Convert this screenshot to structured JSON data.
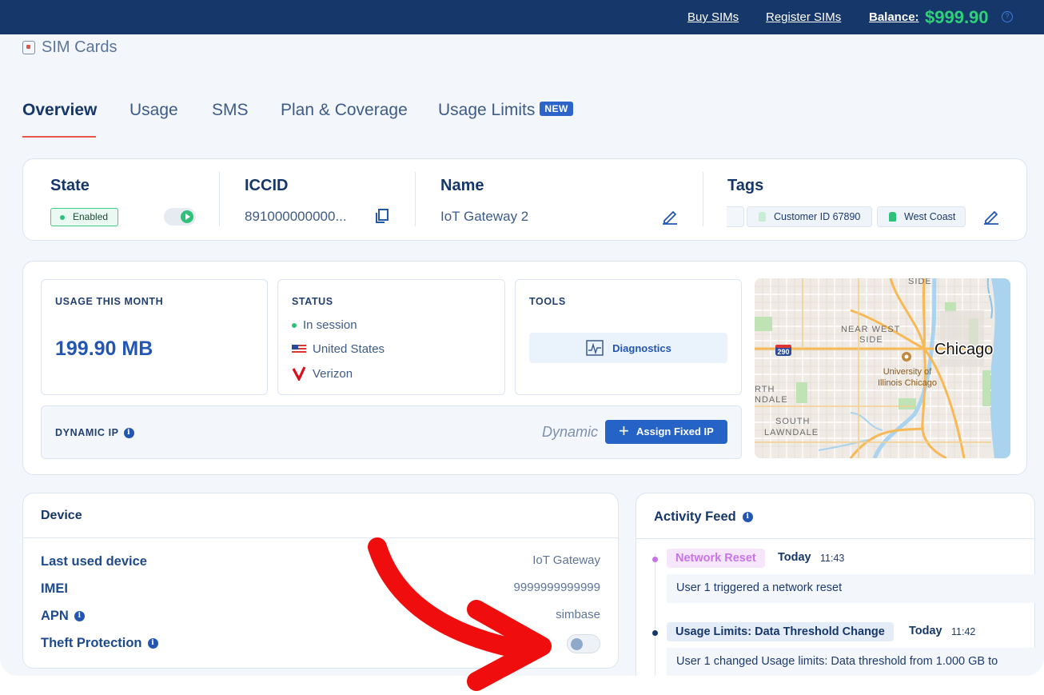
{
  "topbar": {
    "buy_sims": "Buy SIMs",
    "register_sims": "Register SIMs",
    "balance_label": "Balance:",
    "balance_value": "$999.90"
  },
  "page": {
    "title": "SIM Cards"
  },
  "tabs": [
    {
      "label": "Overview",
      "active": true
    },
    {
      "label": "Usage"
    },
    {
      "label": "SMS"
    },
    {
      "label": "Plan & Coverage"
    },
    {
      "label": "Usage Limits",
      "badge": "NEW"
    }
  ],
  "info": {
    "state_title": "State",
    "state_value": "Enabled",
    "iccid_title": "ICCID",
    "iccid_value": "891000000000...",
    "name_title": "Name",
    "name_value": "IoT Gateway 2",
    "tags_title": "Tags",
    "tags": [
      "Customer ID 67890",
      "West Coast"
    ],
    "tag_colors": [
      "#c8ecd6",
      "#2fc079"
    ]
  },
  "overview": {
    "usage_label": "USAGE THIS MONTH",
    "usage_value": "199.90 MB",
    "status_label": "STATUS",
    "status_session": "In session",
    "status_country": "United States",
    "status_carrier": "Verizon",
    "tools_label": "TOOLS",
    "diagnostics_label": "Diagnostics",
    "dynamic_ip_label": "DYNAMIC IP",
    "dynamic_ip_value": "Dynamic",
    "assign_button": "Assign Fixed IP"
  },
  "map": {
    "labels": {
      "top": "SIDE",
      "near_west": "NEAR WEST",
      "near_west_2": "SIDE",
      "highway": "290",
      "chicago": "Chicago",
      "uic_1": "University of",
      "uic_2": "Illinois Chicago",
      "north_lawndale_1": "RTH",
      "north_lawndale_2": "NDALE",
      "south_lawndale_1": "SOUTH",
      "south_lawndale_2": "LAWNDALE"
    }
  },
  "device": {
    "title": "Device",
    "rows": [
      {
        "label": "Last used device",
        "value": "IoT Gateway"
      },
      {
        "label": "IMEI",
        "value": "9999999999999"
      },
      {
        "label": "APN",
        "value": "simbase"
      },
      {
        "label": "Theft Protection",
        "value": ""
      }
    ],
    "theft_protection_enabled": false
  },
  "activity": {
    "title": "Activity Feed",
    "events": [
      {
        "badge": "Network Reset",
        "day": "Today",
        "time": "11:43",
        "desc": "User 1 triggered a network reset"
      },
      {
        "badge": "Usage Limits: Data Threshold Change",
        "day": "Today",
        "time": "11:42",
        "desc": "User 1 changed Usage limits: Data threshold from 1.000 GB to"
      }
    ]
  },
  "colors": {
    "topbar": "#163769",
    "balance": "#2fd07a",
    "accent": "#2563c7",
    "tab_underline": "#e8564a",
    "annotation_arrow": "#f00d0d"
  }
}
